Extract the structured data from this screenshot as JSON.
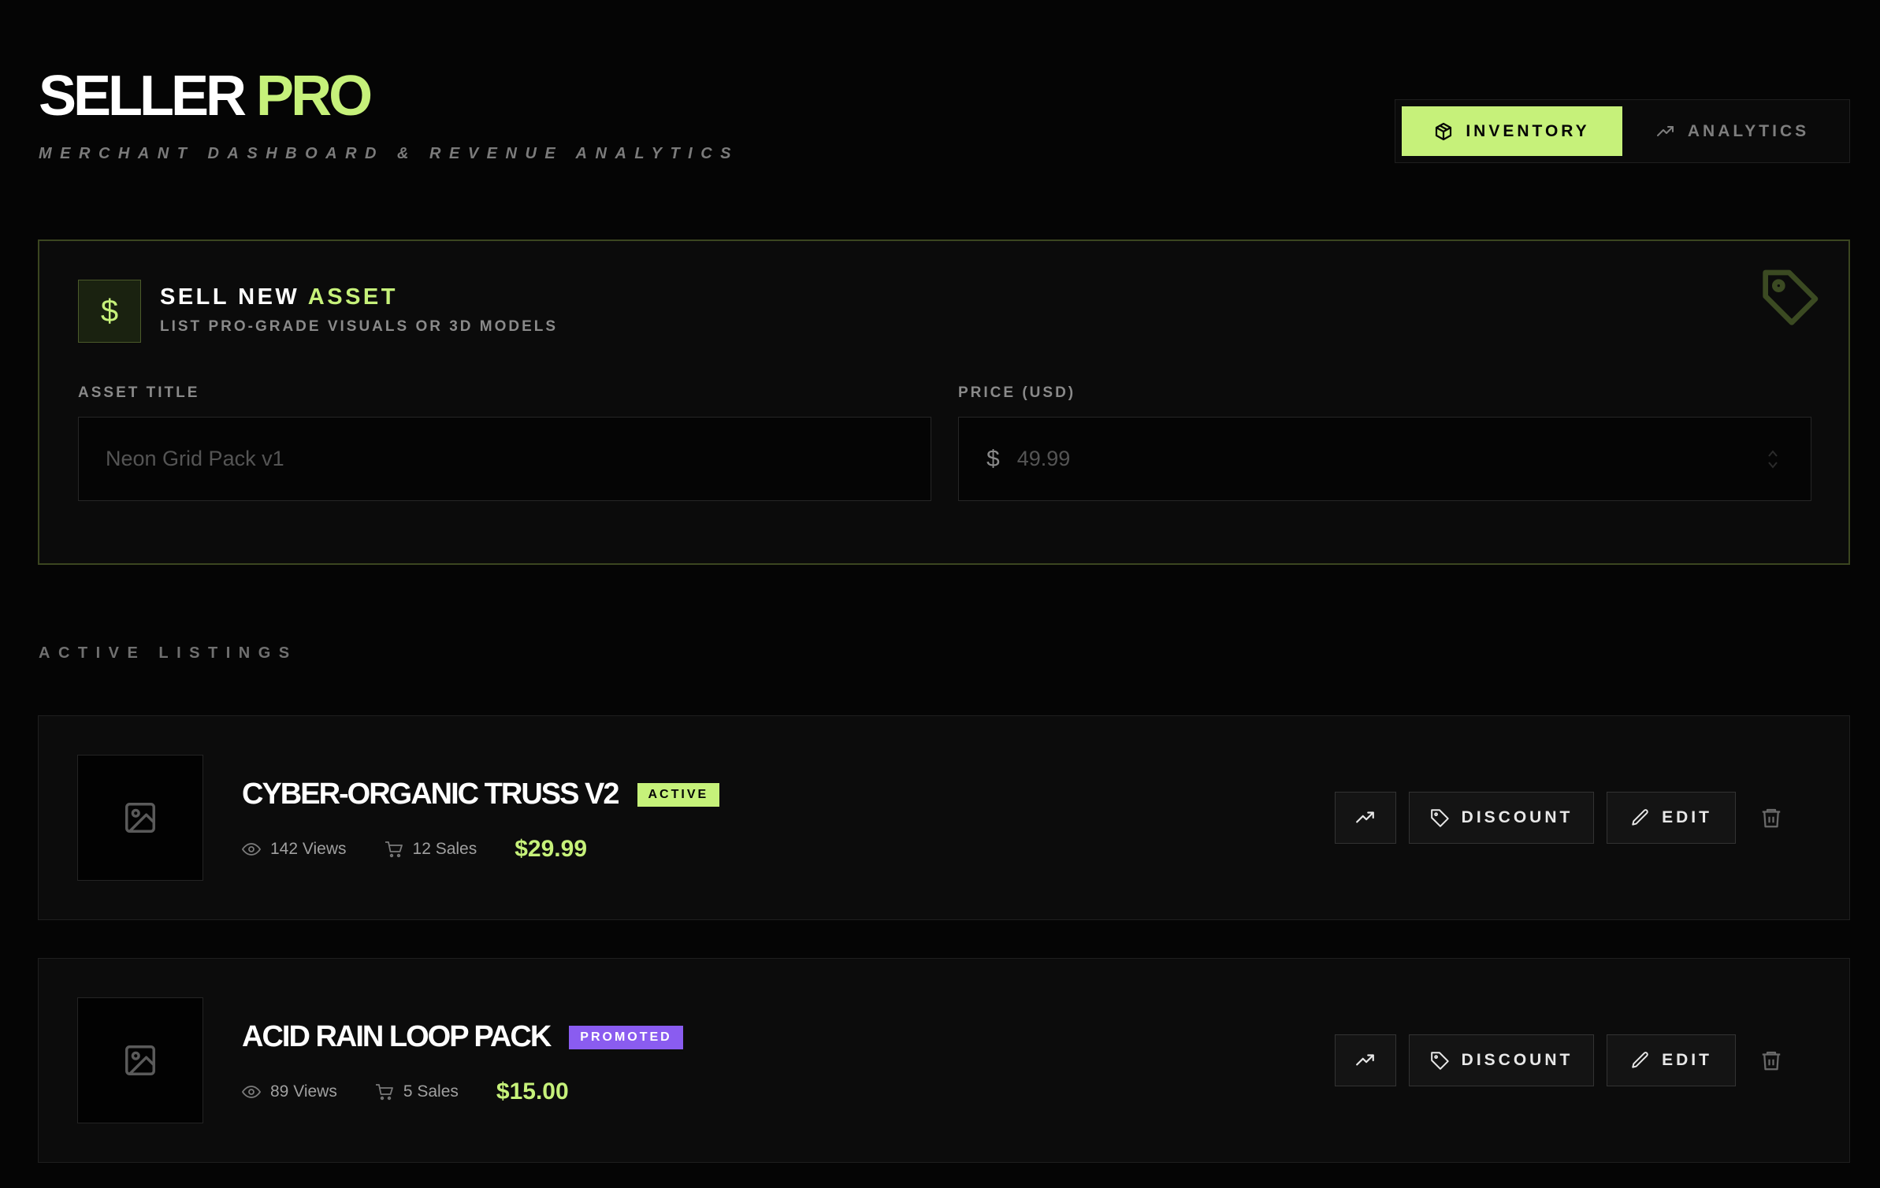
{
  "brand": {
    "name": "SELLER",
    "accent": "PRO",
    "subtitle": "MERCHANT DASHBOARD & REVENUE ANALYTICS"
  },
  "tabs": [
    {
      "label": "INVENTORY",
      "icon": "box-icon",
      "active": true
    },
    {
      "label": "ANALYTICS",
      "icon": "trend-up-icon",
      "active": false
    }
  ],
  "sell": {
    "icon": "dollar-icon",
    "dollar_glyph": "$",
    "title_prefix": "SELL NEW",
    "title_accent": "ASSET",
    "subtitle": "LIST PRO-GRADE VISUALS OR 3D MODELS",
    "title_field": {
      "label": "ASSET TITLE",
      "placeholder": "Neon Grid Pack v1",
      "value": ""
    },
    "price_field": {
      "label": "PRICE (USD)",
      "prefix": "$",
      "placeholder": "49.99",
      "value": ""
    }
  },
  "listings_header": "ACTIVE LISTINGS",
  "listings": [
    {
      "title": "CYBER-ORGANIC TRUSS V2",
      "badge": "ACTIVE",
      "views": "142 Views",
      "sales": "12 Sales",
      "price": "$29.99",
      "actions": {
        "discount": "DISCOUNT",
        "edit": "EDIT"
      }
    },
    {
      "title": "ACID RAIN LOOP PACK",
      "badge": "PROMOTED",
      "views": "89 Views",
      "sales": "5 Sales",
      "price": "$15.00",
      "actions": {
        "discount": "DISCOUNT",
        "edit": "EDIT"
      }
    }
  ],
  "colors": {
    "accent": "#c6f17a",
    "promoted": "#8a5cf0",
    "background": "#050505"
  }
}
